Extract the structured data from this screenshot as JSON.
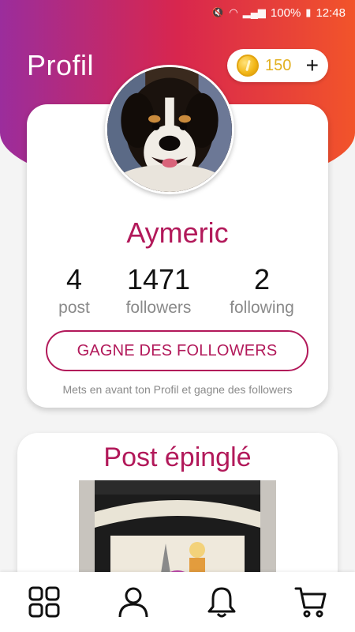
{
  "status_bar": {
    "battery": "100%",
    "time": "12:48"
  },
  "header": {
    "title": "Profil"
  },
  "coins": {
    "count": "150",
    "add": "+"
  },
  "profile": {
    "name": "Aymeric",
    "stats": [
      {
        "value": "4",
        "label": "post"
      },
      {
        "value": "1471",
        "label": "followers"
      },
      {
        "value": "2",
        "label": "following"
      }
    ],
    "button_label": "GAGNE DES FOLLOWERS",
    "hint": "Mets en avant ton Profil et gagne des followers"
  },
  "pinned": {
    "title": "Post épinglé"
  },
  "colors": {
    "accent": "#b2195a",
    "gradient_start": "#9b2d9c",
    "gradient_mid": "#d8264e",
    "gradient_end": "#f2542a",
    "coin": "#e2b020"
  },
  "nav": {
    "items": [
      {
        "icon": "grid-icon"
      },
      {
        "icon": "user-icon"
      },
      {
        "icon": "bell-icon"
      },
      {
        "icon": "cart-icon"
      }
    ]
  }
}
